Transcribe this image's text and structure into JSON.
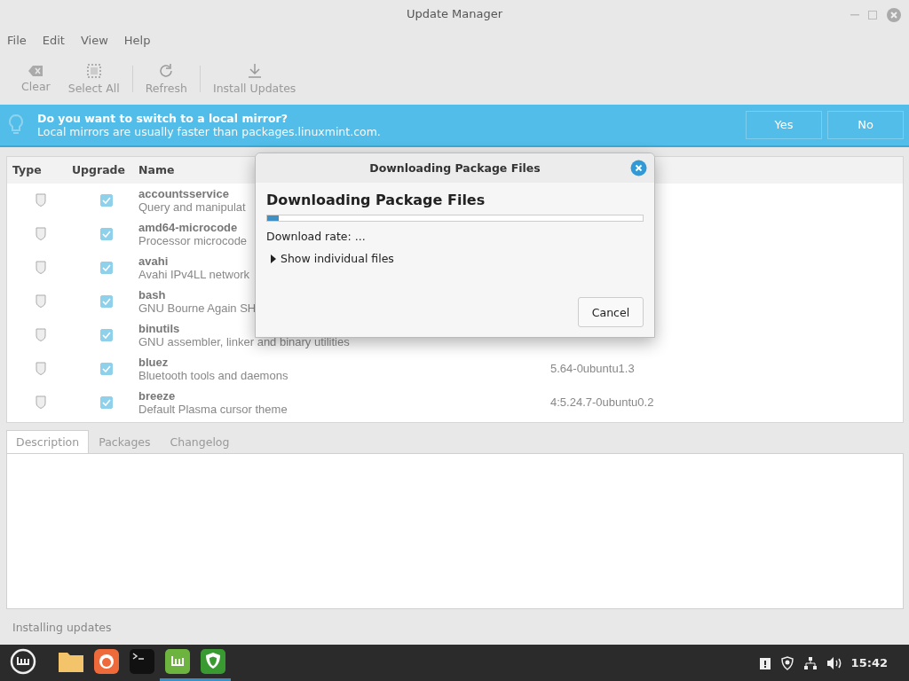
{
  "window": {
    "title": "Update Manager"
  },
  "menu": [
    "File",
    "Edit",
    "View",
    "Help"
  ],
  "toolbar": [
    {
      "kind": "clear",
      "label": "Clear",
      "disabled": true
    },
    {
      "kind": "select",
      "label": "Select All",
      "disabled": true
    },
    {
      "kind": "refresh",
      "label": "Refresh",
      "disabled": true
    },
    {
      "kind": "install",
      "label": "Install Updates",
      "disabled": true
    }
  ],
  "infobar": {
    "title": "Do you want to switch to a local mirror?",
    "text": "Local mirrors are usually faster than packages.linuxmint.com.",
    "buttons": [
      "Yes",
      "No"
    ]
  },
  "table": {
    "columns": [
      "Type",
      "Upgrade",
      "Name"
    ],
    "rows": [
      {
        "checked": true,
        "name": "accountsservice",
        "description": "Query and manipulat"
      },
      {
        "checked": true,
        "name": "amd64-microcode",
        "description": "Processor microcode "
      },
      {
        "checked": true,
        "name": "avahi",
        "description": "Avahi IPv4LL network"
      },
      {
        "checked": true,
        "name": "bash",
        "description": "GNU Bourne Again SH"
      },
      {
        "checked": true,
        "name": "binutils",
        "description": "GNU assembler, linker and binary utilities"
      },
      {
        "checked": true,
        "name": "bluez",
        "description": "Bluetooth tools and daemons",
        "version": "5.64-0ubuntu1.3"
      },
      {
        "checked": true,
        "name": "breeze",
        "description": "Default Plasma cursor theme",
        "version": "4:5.24.7-0ubuntu0.2"
      }
    ]
  },
  "tabs": [
    {
      "label": "Description",
      "selected": true
    },
    {
      "label": "Packages",
      "selected": false
    },
    {
      "label": "Changelog",
      "selected": false
    }
  ],
  "status_bar": "Installing updates",
  "dialog": {
    "title": "Downloading Package Files",
    "heading": "Downloading Package Files",
    "level": 0.03,
    "rate": "Download rate: ...",
    "expander": {
      "label": "Show individual files",
      "expanded": false
    },
    "cancel": "Cancel"
  },
  "taskbar": {
    "apps": [
      {
        "kind": "folder",
        "active": false
      },
      {
        "kind": "browser",
        "active": false
      },
      {
        "kind": "terminal",
        "active": false
      },
      {
        "kind": "mint",
        "active": true
      },
      {
        "kind": "shield",
        "active": true
      }
    ],
    "clock": "15:42"
  }
}
